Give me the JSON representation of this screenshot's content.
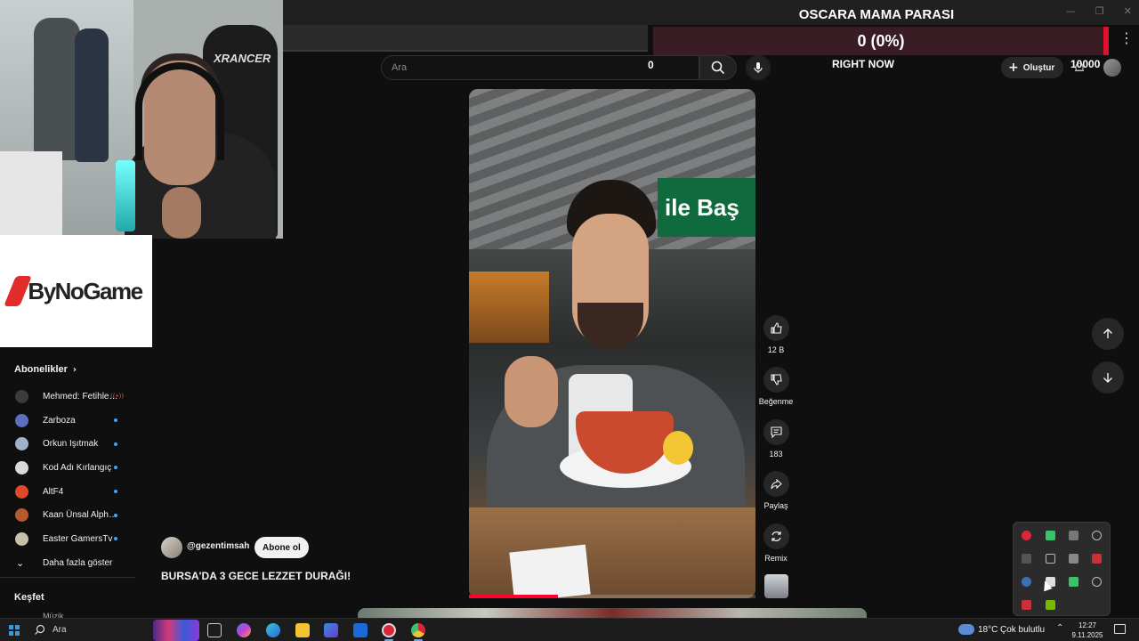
{
  "donation": {
    "title": "OSCARA MAMA PARASI",
    "progress_text": "0 (0%)",
    "progress_fraction": 0,
    "goal": "10000",
    "status": "RIGHT NOW"
  },
  "search": {
    "placeholder": "Ara",
    "overlay_count": "0"
  },
  "header": {
    "create_label": "Oluştur"
  },
  "sponsor": {
    "name": "ByNoGame"
  },
  "sidebar": {
    "subscriptions_title": "Abonelikler",
    "channels": [
      {
        "name": "Mehmed: Fetihle…",
        "status": "live",
        "color": "#3b3b3b"
      },
      {
        "name": "Zarboza",
        "status": "new",
        "color": "#5a6fbf"
      },
      {
        "name": "Orkun Işıtmak",
        "status": "new",
        "color": "#9db4c8"
      },
      {
        "name": "Kod Adı Kırlangıç",
        "status": "new",
        "color": "#d9d9d9"
      },
      {
        "name": "AltF4",
        "status": "new",
        "color": "#e04a2a"
      },
      {
        "name": "Kaan Ünsal Alph…",
        "status": "new",
        "color": "#b55a2a"
      },
      {
        "name": "Easter GamersTv",
        "status": "new",
        "color": "#c8c0a8"
      }
    ],
    "show_more": "Daha fazla göster",
    "explore_title": "Keşfet",
    "music_label": "Müzik"
  },
  "short": {
    "channel_handle": "@gezentimsah",
    "subscribe_label": "Abone ol",
    "title": "BURSA'DA 3 GECE LEZZET DURAĞI!",
    "video_sign_text": "ile Baş",
    "progress_fraction": 0.31,
    "likes": "12 B",
    "dislike_label": "Beğenme",
    "comments": "183",
    "share_label": "Paylaş",
    "remix_label": "Remix"
  },
  "webcam": {
    "chair_brand": "XRANCER"
  },
  "taskbar": {
    "search_label": "Ara",
    "temperature": "18°C",
    "weather": "Çok bulutlu",
    "time": "12:27",
    "date": "9.11.2025"
  },
  "colors": {
    "accent_red": "#ff0033",
    "donation_bar": "#3a1d24",
    "donation_fill": "#e0102a",
    "background": "#0f0f0f"
  }
}
